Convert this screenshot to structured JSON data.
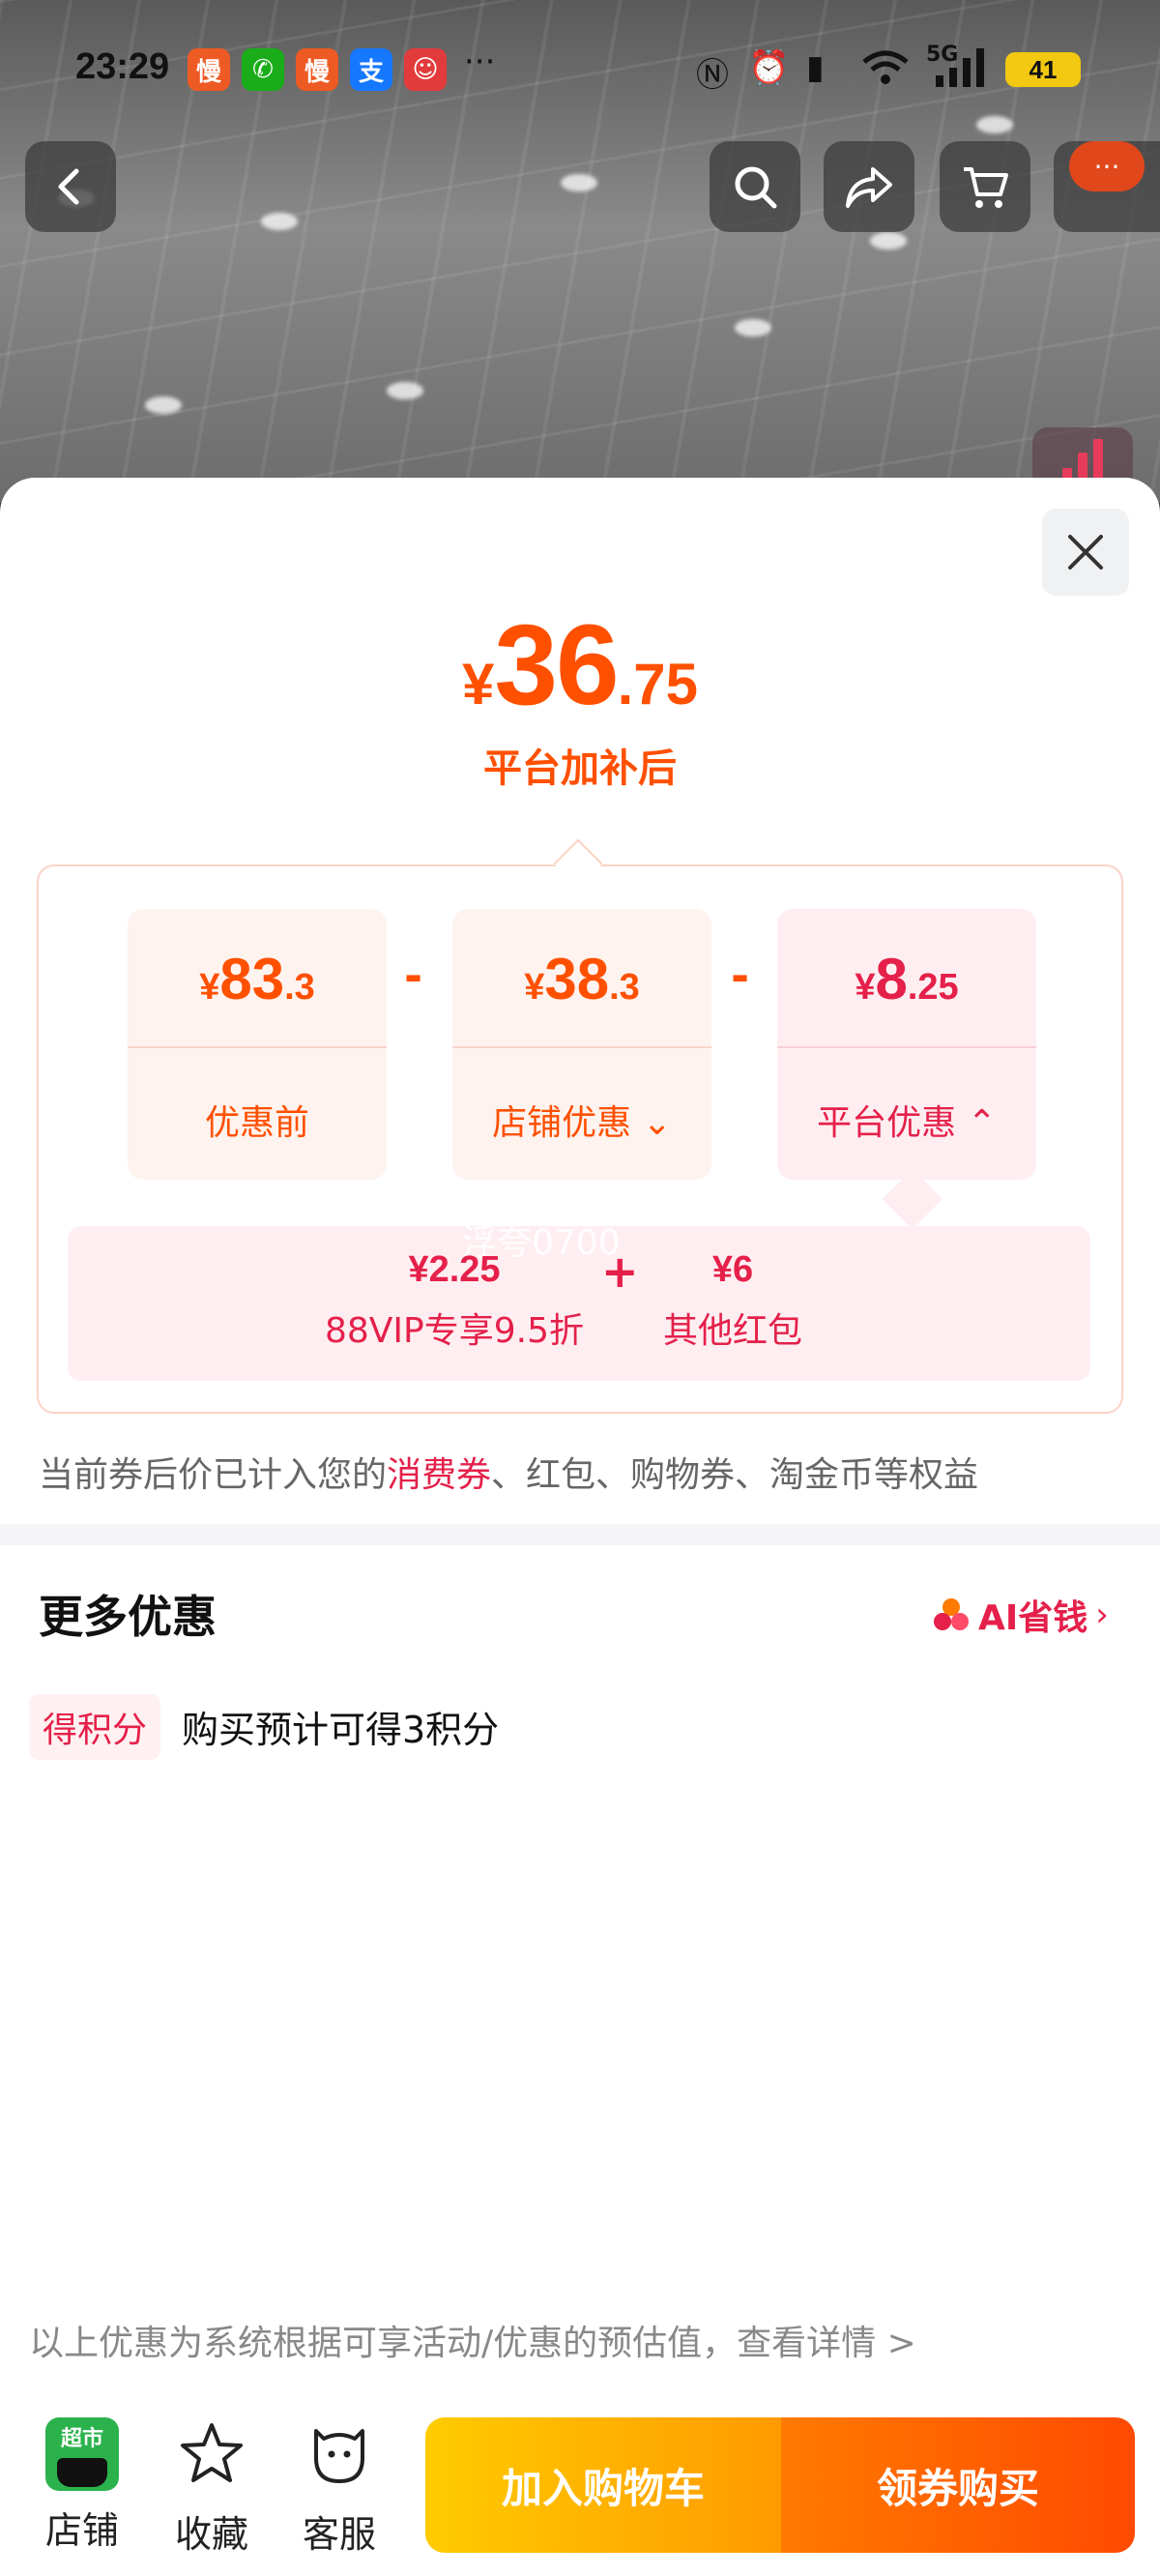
{
  "status_bar": {
    "time": "23:29",
    "apps": [
      {
        "name": "manman-app",
        "glyph": "慢",
        "color": "#ee5a24"
      },
      {
        "name": "wechat-app",
        "glyph": "✆",
        "color": "#1aad19"
      },
      {
        "name": "manman-app-2",
        "glyph": "慢",
        "color": "#ee5a24"
      },
      {
        "name": "alipay-app",
        "glyph": "支",
        "color": "#1677ff"
      },
      {
        "name": "clown-app",
        "glyph": "☺",
        "color": "#e23b3b"
      }
    ],
    "more": "···",
    "network": "5G",
    "battery": "41"
  },
  "nav": {
    "back_icon": "back-arrow-icon",
    "search_icon": "search-icon",
    "share_icon": "share-icon",
    "cart_icon": "cart-icon",
    "menu_badge": "···"
  },
  "price": {
    "currency": "¥",
    "integer": "36",
    "decimal": ".75",
    "caption": "平台加补后"
  },
  "breakdown": {
    "cards": [
      {
        "currency": "¥",
        "integer": "83",
        "decimal": ".3",
        "label": "优惠前",
        "chevron": ""
      },
      {
        "currency": "¥",
        "integer": "38",
        "decimal": ".3",
        "label": "店铺优惠",
        "chevron": "⌄"
      },
      {
        "currency": "¥",
        "integer": "8",
        "decimal": ".25",
        "label": "平台优惠",
        "chevron": "⌃"
      }
    ],
    "operator": "-",
    "platform_items": [
      {
        "amount": "¥2.25",
        "desc": "88VIP专享9.5折"
      },
      {
        "amount": "¥6",
        "desc": "其他红包"
      }
    ],
    "plus": "+",
    "watermark": "浮夸0700"
  },
  "note": {
    "prefix": "当前券后价已计入您的",
    "highlight": "消费券",
    "suffix": "、红包、购物券、淘金币等权益"
  },
  "more_offers": {
    "title": "更多优惠",
    "ai_link": "AI省钱",
    "ai_arrow": "›",
    "points_tag": "得积分",
    "points_text": "购买预计可得3积分"
  },
  "disclaimer": "以上优惠为系统根据可享活动/优惠的预估值，查看详情 >",
  "bottom_bar": {
    "shop_logo_text": "超市",
    "shop_label": "店铺",
    "favorite_label": "收藏",
    "service_label": "客服",
    "add_to_cart": "加入购物车",
    "buy_with_coupon": "领券购买"
  },
  "colors": {
    "accent_orange": "#ff5000",
    "accent_red": "#e5204a"
  }
}
